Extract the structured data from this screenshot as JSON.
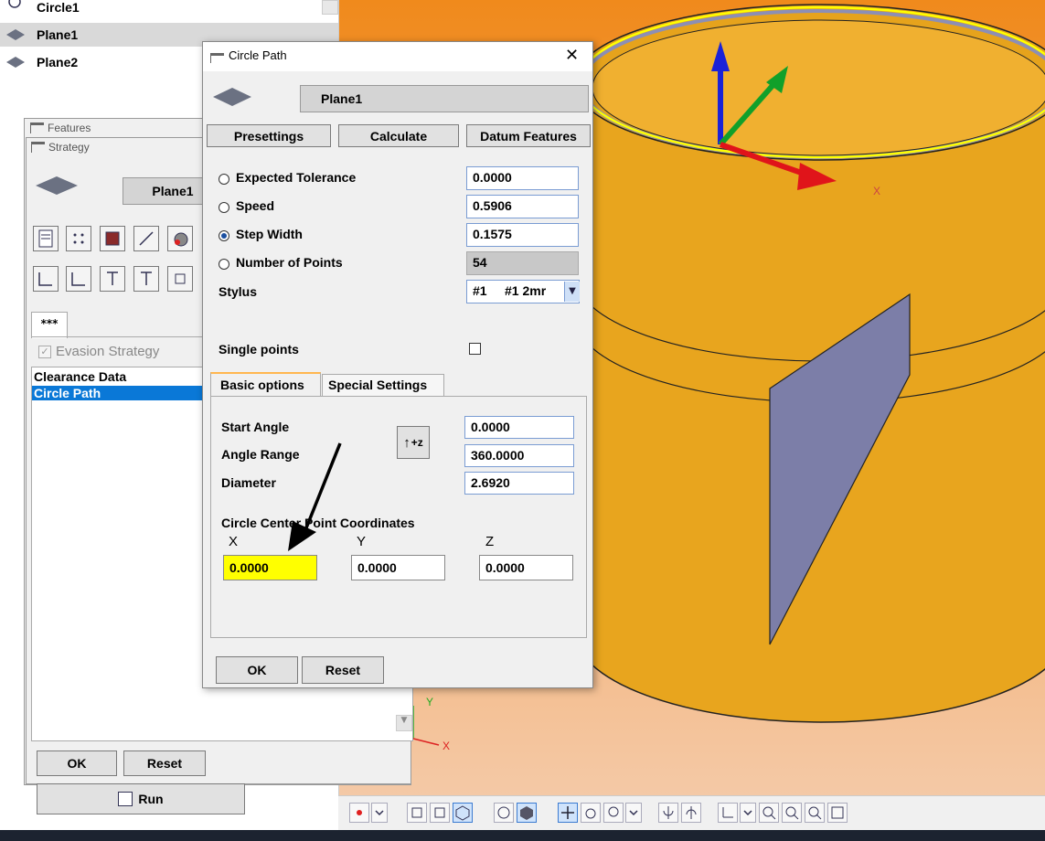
{
  "tree": {
    "items": [
      {
        "label": "Circle1"
      },
      {
        "label": "Plane1"
      },
      {
        "label": "Plane2"
      }
    ]
  },
  "features_window": {
    "title": "Features"
  },
  "strategy_window": {
    "title": "Strategy",
    "feature_name": "Plane1",
    "tab_label": "***",
    "evasion_label": "Evasion Strategy",
    "list_items": [
      "Clearance Data",
      "Circle Path"
    ],
    "ok_label": "OK",
    "reset_label": "Reset"
  },
  "run_button": {
    "label": "Run"
  },
  "dialog": {
    "title": "Circle Path",
    "feature_name": "Plane1",
    "presettings_label": "Presettings",
    "calculate_label": "Calculate",
    "datum_label": "Datum Features",
    "expected_tolerance": {
      "label": "Expected Tolerance",
      "value": "0.0000"
    },
    "speed": {
      "label": "Speed",
      "value": "0.5906"
    },
    "step_width": {
      "label": "Step Width",
      "value": "0.1575"
    },
    "number_of_points": {
      "label": "Number of Points",
      "value": "54"
    },
    "stylus": {
      "label": "Stylus",
      "value": "#1     #1 2mr"
    },
    "single_points_label": "Single points",
    "tabs": [
      "Basic options",
      "Special Settings"
    ],
    "start_angle": {
      "label": "Start Angle",
      "value": "0.0000"
    },
    "angle_range": {
      "label": "Angle Range",
      "value": "360.0000"
    },
    "diameter": {
      "label": "Diameter",
      "value": "2.6920"
    },
    "orient_button_label": "+z",
    "center_title": "Circle Center Point Coordinates",
    "x": {
      "label": "X",
      "value": "0.0000"
    },
    "y": {
      "label": "Y",
      "value": "0.0000"
    },
    "z": {
      "label": "Z",
      "value": "0.0000"
    },
    "ok_label": "OK",
    "reset_label": "Reset"
  },
  "viewport": {
    "axis_x_label": "X",
    "axis_y_label": "Y",
    "triad_x_label": "X",
    "colors": {
      "background_top": "#f08a1c",
      "background_bottom": "#f4c9a6",
      "cylinder": "#e8a51e",
      "cut_face": "#7c7ea8"
    }
  }
}
